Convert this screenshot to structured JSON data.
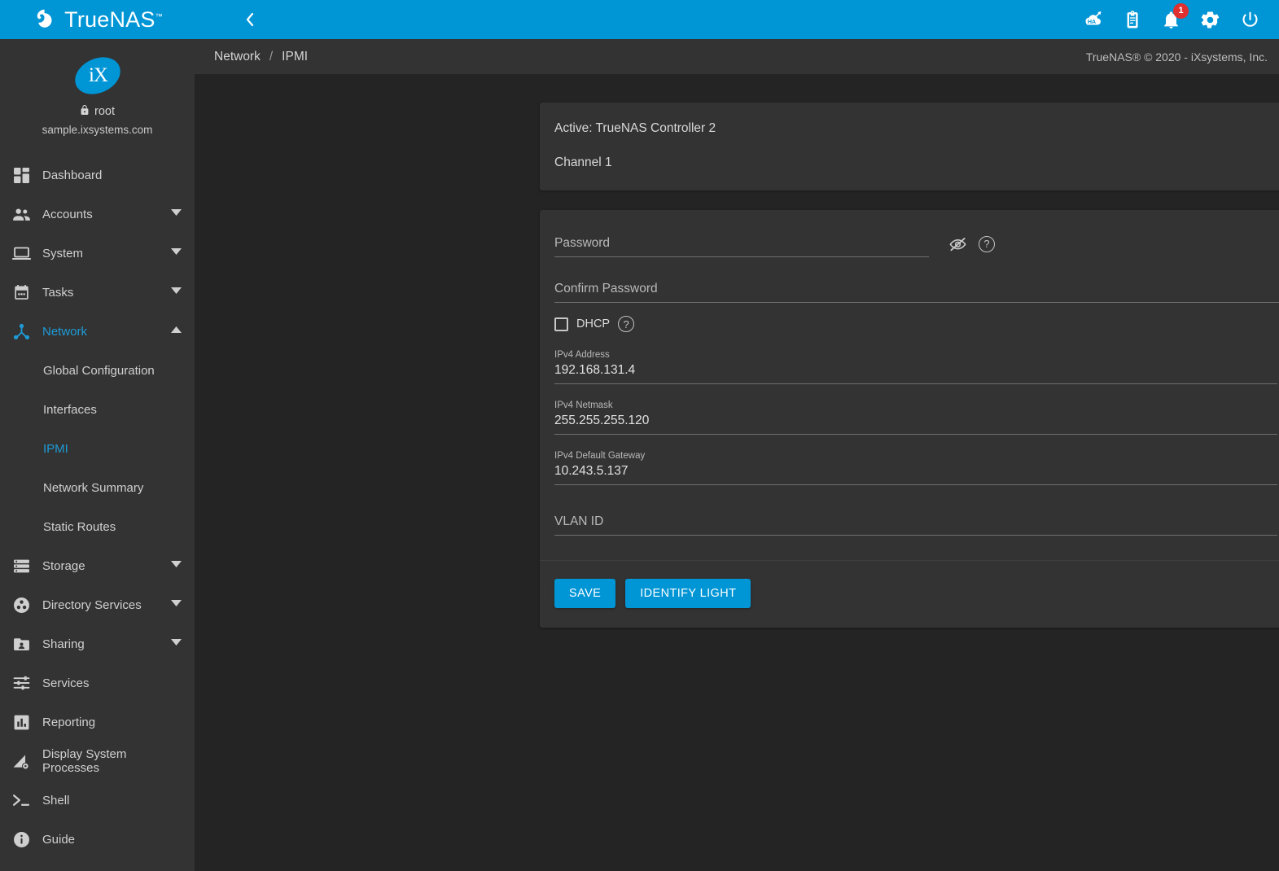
{
  "brand": {
    "name": "TrueNAS",
    "trademark": "™",
    "logo_icon": "truenas-logo"
  },
  "topbar": {
    "menu_icon": "hamburger-menu-icon",
    "back_icon": "chevron-left-icon",
    "ha_icon": "ha-status-icon",
    "ha_label": "HA",
    "tasks_icon": "clipboard-tasks-icon",
    "notifications_icon": "bell-icon",
    "notifications_badge": "1",
    "settings_icon": "gear-icon",
    "power_icon": "power-icon"
  },
  "sidebar": {
    "logo_icon": "ix-logo",
    "logo_text": "iX",
    "lock_icon": "lock-icon",
    "username": "root",
    "hostname": "sample.ixsystems.com",
    "items": [
      {
        "label": "Dashboard",
        "icon": "dashboard-icon",
        "expandable": false
      },
      {
        "label": "Accounts",
        "icon": "accounts-icon",
        "expandable": true
      },
      {
        "label": "System",
        "icon": "system-icon",
        "expandable": true
      },
      {
        "label": "Tasks",
        "icon": "tasks-calendar-icon",
        "expandable": true
      },
      {
        "label": "Network",
        "icon": "network-icon",
        "expandable": true,
        "expanded": true,
        "active": true
      },
      {
        "label": "Storage",
        "icon": "storage-icon",
        "expandable": true
      },
      {
        "label": "Directory Services",
        "icon": "directory-services-icon",
        "expandable": true
      },
      {
        "label": "Sharing",
        "icon": "sharing-folder-icon",
        "expandable": true
      },
      {
        "label": "Services",
        "icon": "services-sliders-icon",
        "expandable": false
      },
      {
        "label": "Reporting",
        "icon": "reporting-chart-icon",
        "expandable": false
      },
      {
        "label": "Display System Processes",
        "icon": "system-processes-icon",
        "expandable": false
      },
      {
        "label": "Shell",
        "icon": "shell-prompt-icon",
        "expandable": false
      },
      {
        "label": "Guide",
        "icon": "guide-info-icon",
        "expandable": false
      }
    ],
    "network_subitems": [
      {
        "label": "Global Configuration",
        "active": false
      },
      {
        "label": "Interfaces",
        "active": false
      },
      {
        "label": "IPMI",
        "active": true
      },
      {
        "label": "Network Summary",
        "active": false
      },
      {
        "label": "Static Routes",
        "active": false
      }
    ]
  },
  "breadcrumb": {
    "parent": "Network",
    "separator": "/",
    "current": "IPMI"
  },
  "footer": {
    "copyright": "TrueNAS® © 2020 - iXsystems, Inc."
  },
  "selectors": {
    "controller": {
      "value": "Active: TrueNAS Controller 2",
      "arrow_icon": "chevron-down-icon"
    },
    "channel": {
      "value": "Channel 1",
      "arrow_icon": "chevron-down-icon"
    }
  },
  "form": {
    "password": {
      "label": "Password",
      "value": "",
      "placeholder": "Password",
      "toggle_icon": "eye-off-icon",
      "help_icon": "help-circle-icon"
    },
    "confirm_password": {
      "label": "Confirm Password",
      "value": "",
      "placeholder": "Confirm Password"
    },
    "dhcp": {
      "label": "DHCP",
      "checked": false,
      "help_icon": "help-circle-icon"
    },
    "ipv4_address": {
      "label": "IPv4 Address",
      "value": "192.168.131.4",
      "help_icon": "help-circle-icon"
    },
    "ipv4_netmask": {
      "label": "IPv4 Netmask",
      "value": "255.255.255.120",
      "help_icon": "help-circle-icon"
    },
    "ipv4_default_gateway": {
      "label": "IPv4 Default Gateway",
      "value": "10.243.5.137",
      "help_icon": "help-circle-icon"
    },
    "vlan_id": {
      "label": "VLAN ID",
      "value": "",
      "placeholder": "VLAN ID",
      "help_icon": "help-circle-icon"
    },
    "actions": {
      "save_label": "SAVE",
      "identify_label": "IDENTIFY LIGHT"
    }
  },
  "colors": {
    "accent": "#0095d5",
    "sidebar_bg": "#333333",
    "page_bg": "#242424",
    "card_bg": "#333333",
    "badge_red": "#e02f2f",
    "active_link": "#1e9bd7"
  }
}
